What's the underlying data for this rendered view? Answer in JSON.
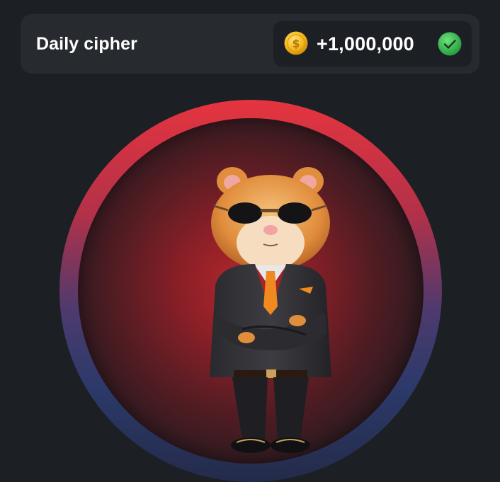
{
  "daily_cipher": {
    "title": "Daily cipher",
    "reward": "+1,000,000",
    "coin_icon": "coin-icon",
    "status_icon": "check-circle-icon",
    "status": "completed"
  },
  "colors": {
    "background": "#1c1f24",
    "card": "#272a2f",
    "check_green": "#3cbb4a",
    "coin_gold": "#f4b81a",
    "ring_top": "#e5343f",
    "ring_bottom": "#2c3a6a"
  },
  "avatar": {
    "character": "hamster-in-suit-icon"
  }
}
